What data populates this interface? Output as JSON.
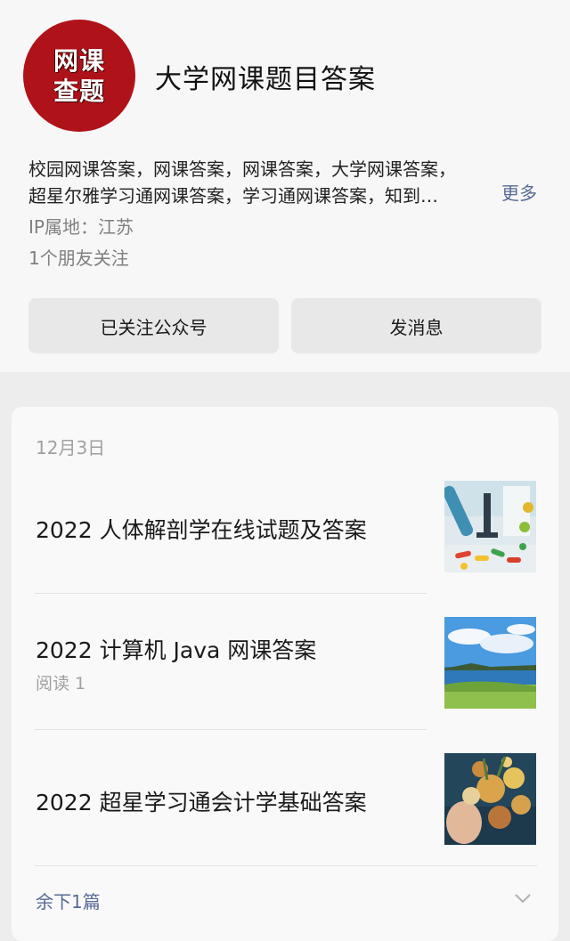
{
  "account": {
    "avatar_text_line1": "网课",
    "avatar_text_line2": "查题",
    "name": "大学网课题目答案",
    "desc_line1": "校园网课答案，网课答案，网课答案，大学网课答案，",
    "desc_line2": "超星尔雅学习通网课答案，学习通网课答案，知到…",
    "more_label": "更多",
    "ip_location": "IP属地：江苏",
    "friends_following": "1个朋友关注",
    "followed_label": "已关注公众号",
    "message_label": "发消息",
    "accent_color": "#576b95",
    "avatar_color": "#b01219"
  },
  "feed": {
    "date": "12月3日",
    "articles": [
      {
        "title": "2022 人体解剖学在线试题及答案",
        "meta": "",
        "thumb_icon": "lab-photo"
      },
      {
        "title": "2022 计算机 Java 网课答案",
        "meta": "阅读 1",
        "thumb_icon": "seascape-photo"
      },
      {
        "title": "2022 超星学习通会计学基础答案",
        "meta": "",
        "thumb_icon": "flowers-portrait-photo"
      }
    ],
    "remaining_label": "余下1篇"
  }
}
